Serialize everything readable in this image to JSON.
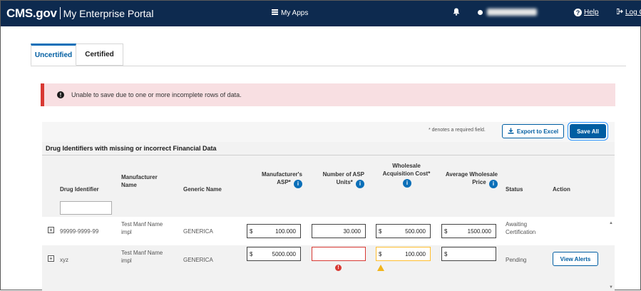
{
  "header": {
    "brand": "CMS.gov",
    "portal": "My Enterprise Portal",
    "my_apps": "My Apps",
    "help": "Help",
    "logout": "Log O"
  },
  "tabs": [
    {
      "label": "Uncertified",
      "active": true
    },
    {
      "label": "Certified",
      "active": false
    }
  ],
  "alert": {
    "message": "Unable to save due to one or more incomplete rows of data."
  },
  "toolbar": {
    "required_note": "* denotes a required field.",
    "export_label": "Export to Excel",
    "save_label": "Save All"
  },
  "section": {
    "title": "Drug Identifiers with missing or incorrect Financial Data"
  },
  "columns": {
    "drug_identifier": "Drug Identifier",
    "manufacturer_name": "Manufacturer Name",
    "generic_name": "Generic Name",
    "manufacturer_asp": "Manufacturer's ASP*",
    "asp_units": "Number of ASP Units*",
    "wac": "Wholesale Acquisition Cost*",
    "awp": "Average Wholesale Price",
    "status": "Status",
    "action": "Action"
  },
  "rows": [
    {
      "drug_identifier": "99999-9999-99",
      "manufacturer_name": "Test Manf Name impl",
      "generic_name": "GENERICA",
      "asp_prefix": "$",
      "asp": "100.000",
      "asp_units": "30.000",
      "wac_prefix": "$",
      "wac": "500.000",
      "awp_prefix": "$",
      "awp": "1500.000",
      "status": "Awaiting Certification",
      "action": ""
    },
    {
      "drug_identifier": "xyz",
      "manufacturer_name": "Test Manf Name impl",
      "generic_name": "GENERICA",
      "asp_prefix": "$",
      "asp": "5000.000",
      "asp_units": "",
      "wac_prefix": "$",
      "wac": "100.000",
      "awp_prefix": "$",
      "awp": "",
      "status": "Pending",
      "action": "View Alerts"
    }
  ],
  "colors": {
    "header_bg": "#0d2a4f",
    "primary": "#005ea2",
    "error": "#d83933",
    "warning": "#ffbe2e",
    "alert_bg": "#f8dfe2"
  }
}
